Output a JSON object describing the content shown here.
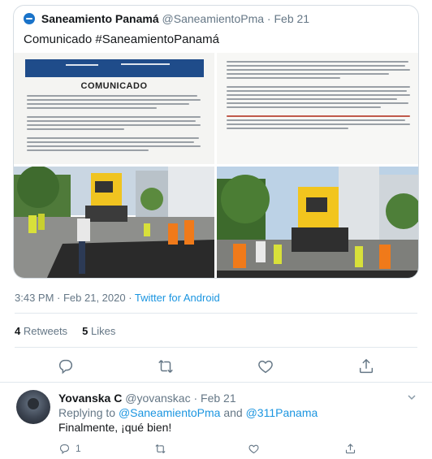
{
  "quoted_tweet": {
    "name": "Saneamiento Panamá",
    "handle": "@SaneamientoPma",
    "separator": "·",
    "date": "Feb 21",
    "text": "Comunicado #SaneamientoPanamá",
    "document_heading": "COMUNICADO"
  },
  "post": {
    "time": "3:43 PM · Feb 21, 2020",
    "separator": " · ",
    "source": "Twitter for Android"
  },
  "stats": {
    "retweets_count": "4",
    "retweets_label": "Retweets",
    "likes_count": "5",
    "likes_label": "Likes"
  },
  "actions": {
    "icons": [
      "reply-icon",
      "retweet-icon",
      "like-icon",
      "share-icon"
    ]
  },
  "reply": {
    "name": "Yovanska C",
    "handle": "@yovanskac",
    "separator": "·",
    "date": "Feb 21",
    "replying_prefix": "Replying to ",
    "mention1": "@SaneamientoPma",
    "and": " and ",
    "mention2": "@311Panama",
    "text": "Finalmente, ¡qué bien!",
    "reply_count": "1"
  },
  "colors": {
    "link": "#1b95e0",
    "muted": "#657786",
    "text": "#14171a",
    "border": "#e1e8ed"
  }
}
